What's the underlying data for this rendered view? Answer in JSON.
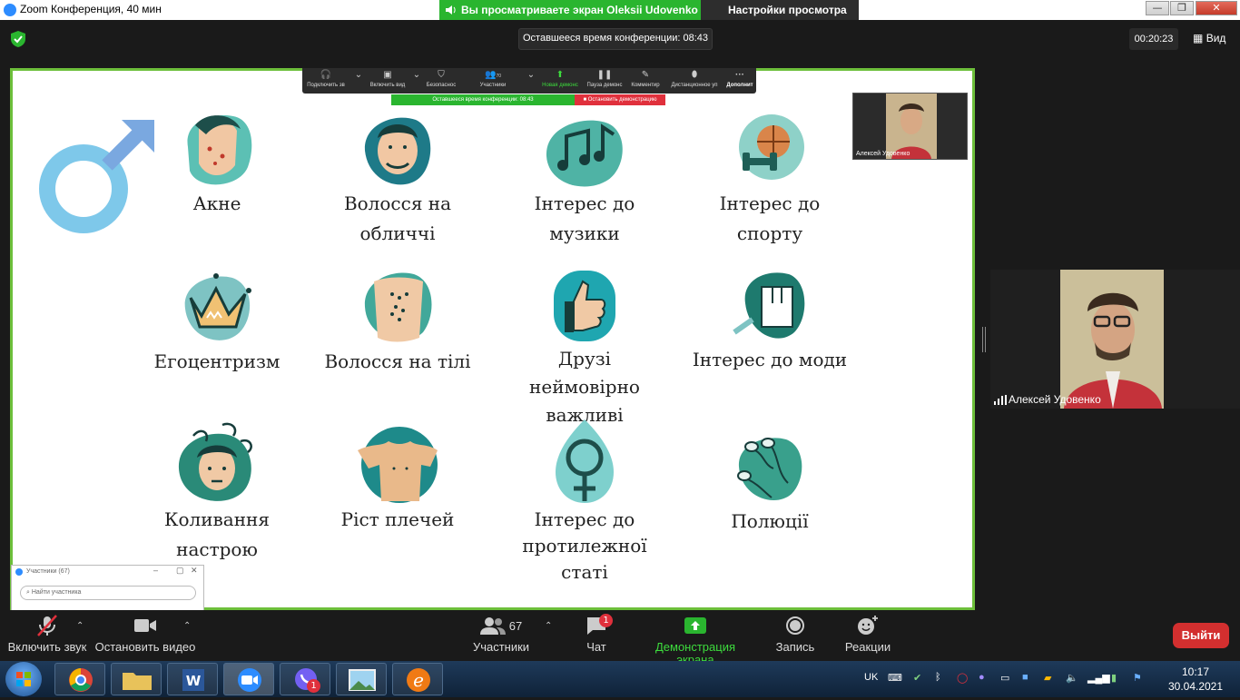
{
  "window": {
    "title": "Zoom Конференция, 40 мин",
    "share_banner": "Вы просматриваете экран Oleksii Udovenko",
    "view_settings": "Настройки просмотра",
    "controls": [
      "—",
      "❐",
      "✕"
    ]
  },
  "topbar": {
    "remaining_time": "Оставшееся время конференции: 08:43",
    "elapsed": "00:20:23",
    "view_label": "Вид"
  },
  "slide": {
    "tiles": [
      {
        "label": "Акне",
        "icon": "acne-face-icon"
      },
      {
        "label": "Волосся на обличчі",
        "icon": "facial-hair-face-icon"
      },
      {
        "label": "Інтерес до музики",
        "icon": "music-notes-icon"
      },
      {
        "label": "Інтерес до спорту",
        "icon": "basketball-dumbbell-icon"
      },
      {
        "label": "Егоцентризм",
        "icon": "crown-icon"
      },
      {
        "label": "Волосся на тілі",
        "icon": "body-hair-torso-icon"
      },
      {
        "label": "Друзі неймовірно важливі",
        "icon": "thumbs-up-icon"
      },
      {
        "label": "Інтерес до моди",
        "icon": "shirt-icon"
      },
      {
        "label": "Коливання настрою",
        "icon": "moody-face-icon"
      },
      {
        "label": "Ріст плечей",
        "icon": "shoulders-torso-icon"
      },
      {
        "label": "Інтерес до протилежної статі",
        "icon": "female-symbol-icon"
      },
      {
        "label": "Полюції",
        "icon": "sperm-icon"
      }
    ]
  },
  "sharebar": {
    "items": [
      {
        "label": "Подключить зв",
        "icon": "headphones-icon"
      },
      {
        "label": "Включить вид",
        "icon": "video-off-icon"
      },
      {
        "label": "Безопаснос",
        "icon": "shield-icon"
      },
      {
        "label": "Участники",
        "icon": "participants-icon",
        "count": "70"
      },
      {
        "label": "Новая демонс",
        "icon": "share-icon"
      },
      {
        "label": "Пауза демонс",
        "icon": "pause-icon"
      },
      {
        "label": "Комментир",
        "icon": "pen-icon"
      },
      {
        "label": "Дистанционное уп",
        "icon": "mouse-icon"
      },
      {
        "label": "Дополнит",
        "icon": "more-icon"
      }
    ],
    "status": "Оставшееся время конференции: 08:43",
    "stop": "Остановить демонстрацию"
  },
  "thumb_video": {
    "name": "Алексей Удовенко"
  },
  "right_video": {
    "name": "Алексей Удовенко"
  },
  "participants_window": {
    "title": "Участники (67)",
    "search_placeholder": "Найти участника"
  },
  "toolbar": {
    "mute": "Включить звук",
    "video": "Остановить видео",
    "participants": "Участники",
    "participants_count": "67",
    "chat": "Чат",
    "chat_badge": "1",
    "share": "Демонстрация экрана",
    "record": "Запись",
    "reactions": "Реакции",
    "leave": "Выйти"
  },
  "taskbar": {
    "lang": "UK",
    "time": "10:17",
    "date": "30.04.2021",
    "viber_badge": "1"
  },
  "colors": {
    "teal_dark": "#1e7a66",
    "teal_light": "#7cc9bf",
    "skin": "#e9b98a",
    "green_border": "#6dbf3b",
    "share_green": "#2ab52f"
  }
}
